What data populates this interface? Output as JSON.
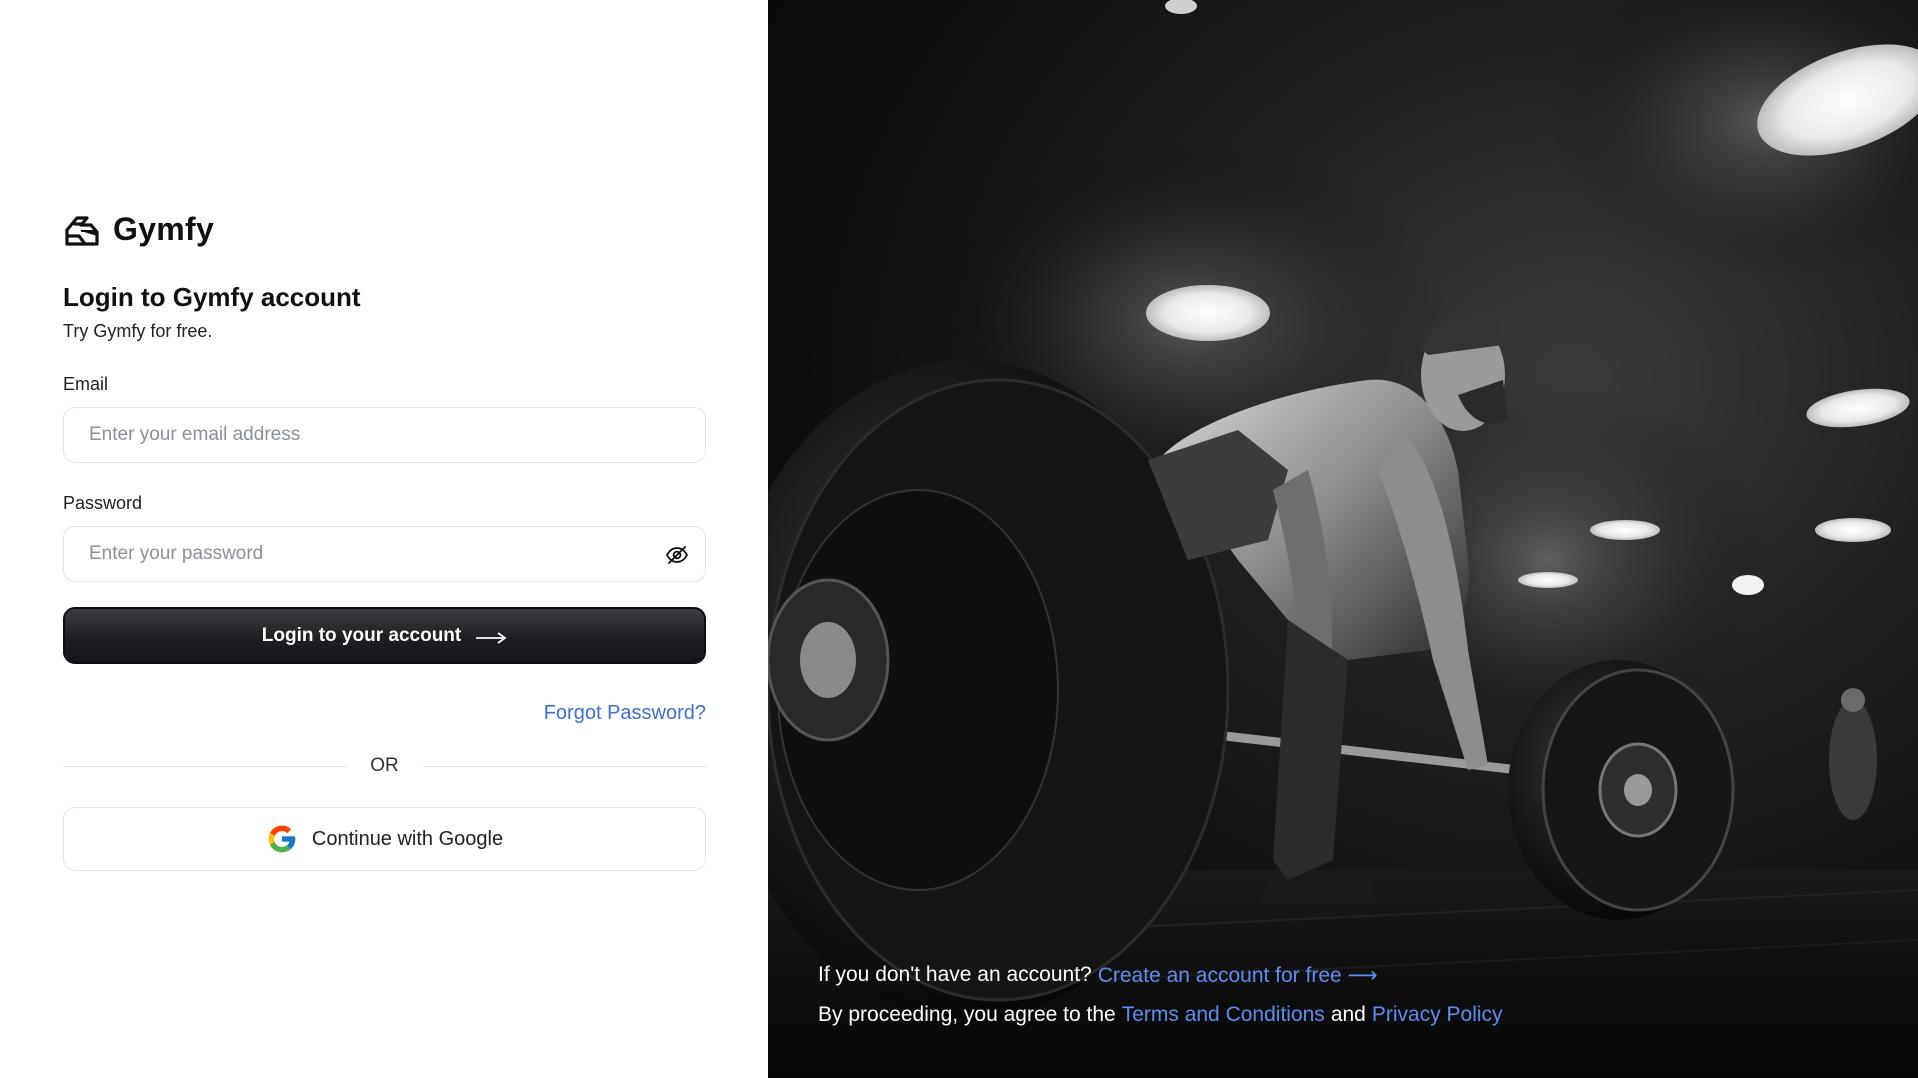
{
  "brand": {
    "name": "Gymfy",
    "logo_icon": "gymfy-logo-icon"
  },
  "login": {
    "heading": "Login to Gymfy account",
    "subheading": "Try Gymfy for free.",
    "email_label": "Email",
    "email_placeholder": "Enter your email address",
    "email_value": "",
    "password_label": "Password",
    "password_placeholder": "Enter your password",
    "password_value": "",
    "password_toggle_icon": "eye-off-icon",
    "submit_label": "Login to your account",
    "submit_icon": "arrow-right-icon",
    "forgot_label": "Forgot Password?",
    "divider_label": "OR",
    "google_label": "Continue with Google",
    "google_icon": "google-icon"
  },
  "hero": {
    "image_desc_icon": "gym-deadlift-photo",
    "signup_prompt": "If you don't have an account?",
    "signup_link": "Create an account for free",
    "signup_arrow": "⟶",
    "terms_prefix": "By proceeding, you agree to the",
    "terms_link": "Terms and Conditions",
    "terms_and": "and",
    "privacy_link": "Privacy Policy"
  },
  "colors": {
    "link": "#3a6fd6",
    "hero_link": "#5b8ff0",
    "button_dark": "#1d1f23"
  }
}
